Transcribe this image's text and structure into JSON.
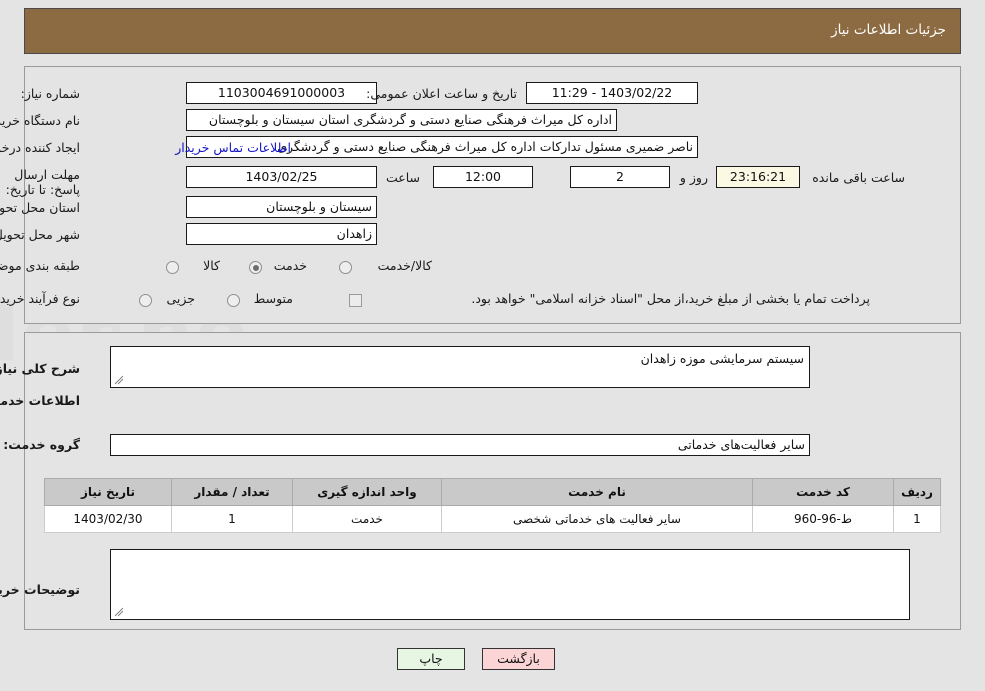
{
  "header": {
    "title": "جزئیات اطلاعات نیاز"
  },
  "form": {
    "need_number_label": "شماره نیاز:",
    "need_number_value": "1103004691000003",
    "public_announce_label": "تاریخ و ساعت اعلان عمومی:",
    "public_announce_value": "1403/02/22 - 11:29",
    "buyer_org_label": "نام دستگاه خریدار:",
    "buyer_org_value": "اداره کل میراث فرهنگی  صنایع دستی و گردشگری استان سیستان و بلوچستان",
    "creator_label": "ایجاد کننده درخواست:",
    "creator_value": "ناصر ضمیری مسئول تدارکات اداره کل میراث فرهنگی  صنایع دستی و گردشگری",
    "contact_link": "اطلاعات تماس خریدار",
    "deadline_label": "مهلت ارسال پاسخ: تا تاریخ:",
    "deadline_date": "1403/02/25",
    "hour_label": "ساعت",
    "hour_value": "12:00",
    "days_value": "2",
    "days_label": "روز و",
    "countdown_value": "23:16:21",
    "countdown_label": "ساعت باقی مانده",
    "province_label": "استان محل تحویل:",
    "province_value": "سیستان و بلوچستان",
    "city_label": "شهر محل تحویل:",
    "city_value": "زاهدان",
    "category_label": "طبقه بندی موضوعی:",
    "category_options": [
      {
        "label": "کالا",
        "selected": false
      },
      {
        "label": "خدمت",
        "selected": true
      },
      {
        "label": "کالا/خدمت",
        "selected": false
      }
    ],
    "process_label": "نوع فرآیند خرید :",
    "process_options": [
      {
        "label": "جزیی",
        "selected": false
      },
      {
        "label": "متوسط",
        "selected": false
      }
    ],
    "treasury_checkbox_label": "پرداخت تمام یا بخشی از مبلغ خرید،از محل \"اسناد خزانه اسلامی\" خواهد بود.",
    "treasury_checked": false
  },
  "description": {
    "general_need_label": "شرح کلی نیاز:",
    "general_need_value": "سیستم سرمایشی موزه زاهدان",
    "services_heading": "اطلاعات خدمات مورد نیاز",
    "service_group_label": "گروه خدمت:",
    "service_group_value": "سایر فعالیت‌های خدماتی",
    "buyer_notes_label": "توضیحات خریدار:",
    "buyer_notes_value": ""
  },
  "table": {
    "columns": [
      "ردیف",
      "کد خدمت",
      "نام خدمت",
      "واحد اندازه گیری",
      "تعداد / مقدار",
      "تاریخ نیاز"
    ],
    "rows": [
      {
        "row": "1",
        "code": "ط-96-960",
        "name": "سایر فعالیت های خدماتی شخصی",
        "unit": "خدمت",
        "qty": "1",
        "date": "1403/02/30"
      }
    ]
  },
  "footer": {
    "print_label": "چاپ",
    "back_label": "بازگشت"
  },
  "colors": {
    "header_bg": "#8c6b42",
    "link": "#1414c8",
    "table_header_bg": "#c9c9c9",
    "print_bg": "#e7f5e3",
    "back_bg": "#fbd5d5",
    "countdown_bg": "#fbf8e3"
  }
}
